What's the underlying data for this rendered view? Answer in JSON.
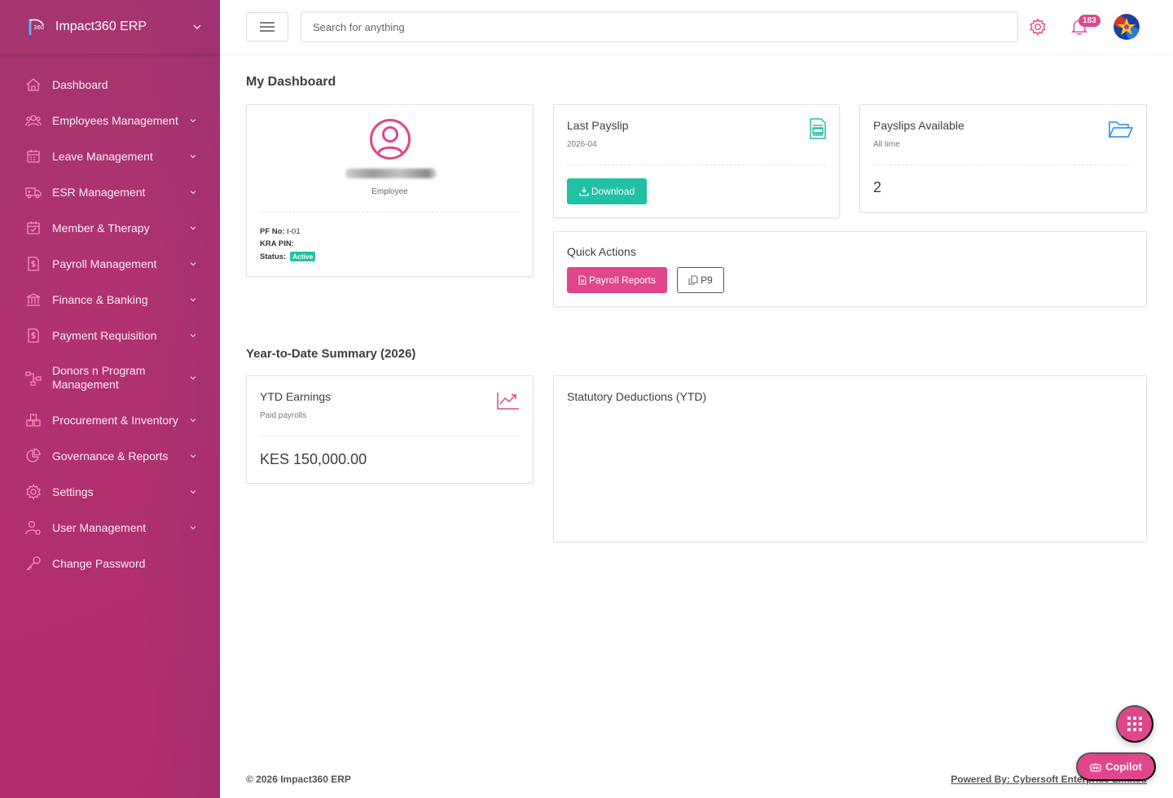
{
  "brand": {
    "name": "Impact360 ERP",
    "logo_icon": "impact360-logo-icon"
  },
  "sidebar": {
    "items": [
      {
        "label": "Dashboard",
        "icon": "home-icon",
        "has_submenu": false
      },
      {
        "label": "Employees Management",
        "icon": "users-icon",
        "has_submenu": true
      },
      {
        "label": "Leave Management",
        "icon": "calendar-icon",
        "has_submenu": true
      },
      {
        "label": "ESR Management",
        "icon": "truck-icon",
        "has_submenu": true
      },
      {
        "label": "Member & Therapy",
        "icon": "calendar-check-icon",
        "has_submenu": true
      },
      {
        "label": "Payroll Management",
        "icon": "dollar-doc-icon",
        "has_submenu": true
      },
      {
        "label": "Finance & Banking",
        "icon": "bank-icon",
        "has_submenu": true
      },
      {
        "label": "Payment Requisition",
        "icon": "requisition-doc-icon",
        "has_submenu": true
      },
      {
        "label": "Donors n Program Management",
        "icon": "network-icon",
        "has_submenu": true
      },
      {
        "label": "Procurement & Inventory",
        "icon": "boxes-icon",
        "has_submenu": true
      },
      {
        "label": "Governance & Reports",
        "icon": "pie-chart-icon",
        "has_submenu": true
      },
      {
        "label": "Settings",
        "icon": "gear-icon",
        "has_submenu": true
      },
      {
        "label": "User Management",
        "icon": "user-gear-icon",
        "has_submenu": true
      },
      {
        "label": "Change Password",
        "icon": "key-icon",
        "has_submenu": false
      }
    ]
  },
  "topbar": {
    "search_placeholder": "Search for anything",
    "notification_count": "183"
  },
  "dashboard": {
    "title": "My Dashboard",
    "profile": {
      "role": "Employee",
      "pf_label": "PF No:",
      "pf_value": "I-01",
      "kra_label": "KRA PIN:",
      "kra_value": "",
      "status_label": "Status:",
      "status_value": "Active"
    },
    "last_payslip": {
      "title": "Last Payslip",
      "period": "2026-04",
      "download_label": "Download"
    },
    "payslips_available": {
      "title": "Payslips Available",
      "subtitle": "All time",
      "count": "2"
    },
    "quick_actions": {
      "title": "Quick Actions",
      "payroll_reports_label": "Payroll Reports",
      "p9_label": "P9"
    }
  },
  "ytd": {
    "section_title": "Year-to-Date Summary (2026)",
    "earnings": {
      "title": "YTD Earnings",
      "subtitle": "Paid payrolls",
      "value": "KES 150,000.00"
    },
    "deductions": {
      "title": "Statutory Deductions (YTD)"
    }
  },
  "footer": {
    "copyright": "© 2026 Impact360 ERP",
    "powered_by": "Powered By: Cybersoft Enterprise Limited"
  },
  "copilot": {
    "label": "Copilot"
  },
  "colors": {
    "brand_pink": "#e0468a",
    "sidebar_bg": "#ab3170",
    "teal": "#21c1a5",
    "blue": "#1e88e5"
  }
}
